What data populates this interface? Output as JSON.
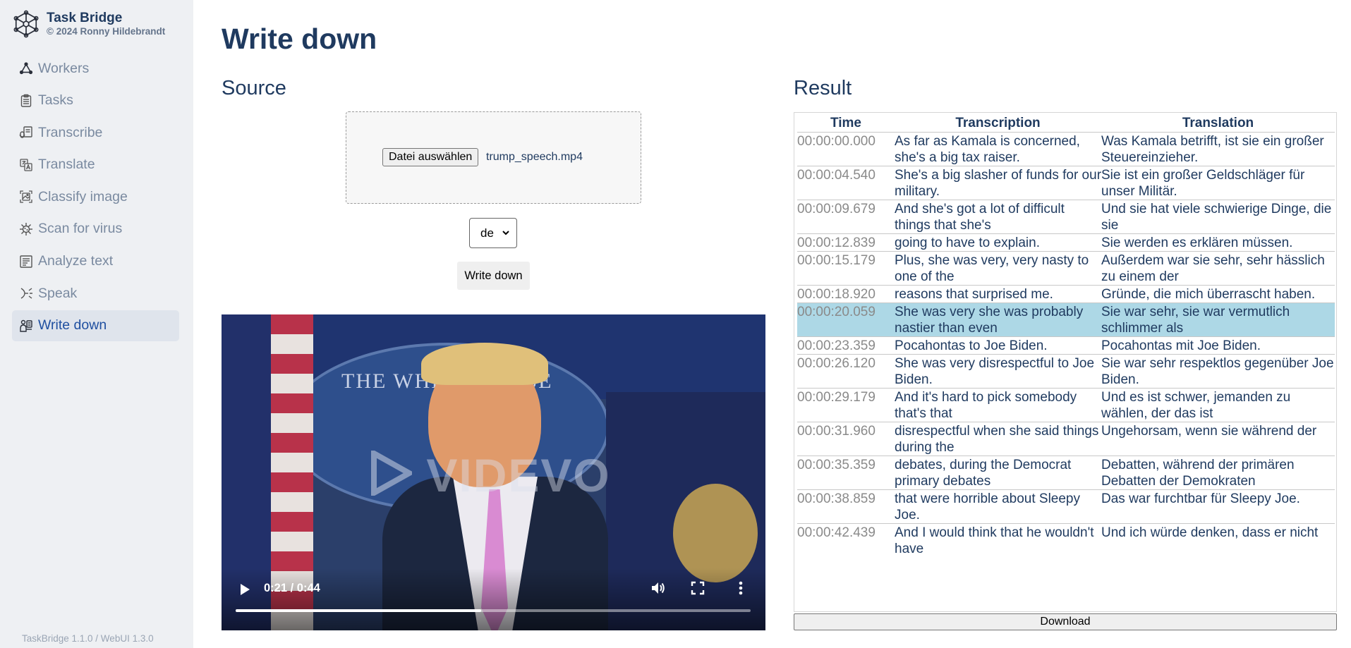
{
  "app": {
    "name": "Task Bridge",
    "copyright": "© 2024 Ronny Hildebrandt",
    "version": "TaskBridge 1.1.0 / WebUI 1.3.0"
  },
  "sidebar": {
    "items": [
      {
        "label": "Workers",
        "icon": "workers-icon"
      },
      {
        "label": "Tasks",
        "icon": "tasks-icon"
      },
      {
        "label": "Transcribe",
        "icon": "transcribe-icon"
      },
      {
        "label": "Translate",
        "icon": "translate-icon"
      },
      {
        "label": "Classify image",
        "icon": "classify-image-icon"
      },
      {
        "label": "Scan for virus",
        "icon": "virus-icon"
      },
      {
        "label": "Analyze text",
        "icon": "analyze-text-icon"
      },
      {
        "label": "Speak",
        "icon": "speak-icon"
      },
      {
        "label": "Write down",
        "icon": "write-down-icon",
        "active": true
      }
    ]
  },
  "page": {
    "title": "Write down",
    "source_heading": "Source",
    "result_heading": "Result"
  },
  "source": {
    "file_button": "Datei auswählen",
    "file_name": "trump_speech.mp4",
    "language": "de",
    "submit_label": "Write down"
  },
  "video": {
    "time_display": "0:21 / 0:44",
    "progress": 0.477,
    "watermark": "VIDEVO",
    "backdrop_text": "THE WHITE HOUSE"
  },
  "result": {
    "columns": [
      "Time",
      "Transcription",
      "Translation"
    ],
    "rows": [
      {
        "time": "00:00:00.000",
        "transcription": "As far as Kamala is concerned, she's a big tax raiser.",
        "translation": "Was Kamala betrifft, ist sie ein großer Steuereinzieher."
      },
      {
        "time": "00:00:04.540",
        "transcription": "She's a big slasher of funds for our military.",
        "translation": "Sie ist ein großer Geldschläger für unser Militär."
      },
      {
        "time": "00:00:09.679",
        "transcription": "And she's got a lot of difficult things that she's",
        "translation": "Und sie hat viele schwierige Dinge, die sie"
      },
      {
        "time": "00:00:12.839",
        "transcription": "going to have to explain.",
        "translation": "Sie werden es erklären müssen."
      },
      {
        "time": "00:00:15.179",
        "transcription": "Plus, she was very, very nasty to one of the",
        "translation": "Außerdem war sie sehr, sehr hässlich zu einem der"
      },
      {
        "time": "00:00:18.920",
        "transcription": "reasons that surprised me.",
        "translation": "Gründe, die mich überrascht haben."
      },
      {
        "time": "00:00:20.059",
        "transcription": "She was very she was probably nastier than even",
        "translation": "Sie war sehr, sie war vermutlich schlimmer als",
        "highlight": true
      },
      {
        "time": "00:00:23.359",
        "transcription": "Pocahontas to Joe Biden.",
        "translation": "Pocahontas mit Joe Biden."
      },
      {
        "time": "00:00:26.120",
        "transcription": "She was very disrespectful to Joe Biden.",
        "translation": "Sie war sehr respektlos gegenüber Joe Biden."
      },
      {
        "time": "00:00:29.179",
        "transcription": "And it's hard to pick somebody that's that",
        "translation": "Und es ist schwer, jemanden zu wählen, der das ist"
      },
      {
        "time": "00:00:31.960",
        "transcription": "disrespectful when she said things during the",
        "translation": "Ungehorsam, wenn sie während der"
      },
      {
        "time": "00:00:35.359",
        "transcription": "debates, during the Democrat primary debates",
        "translation": "Debatten, während der primären Debatten der Demokraten"
      },
      {
        "time": "00:00:38.859",
        "transcription": "that were horrible about Sleepy Joe.",
        "translation": "Das war furchtbar für Sleepy Joe."
      },
      {
        "time": "00:00:42.439",
        "transcription": "And I would think that he wouldn't have",
        "translation": "Und ich würde denken, dass er nicht"
      }
    ],
    "download_label": "Download"
  },
  "colors": {
    "sidebar_bg": "#eef0f3",
    "active_item_bg": "#dfe4ec",
    "heading": "#1f3a5f",
    "highlight_row": "#add8e6"
  }
}
